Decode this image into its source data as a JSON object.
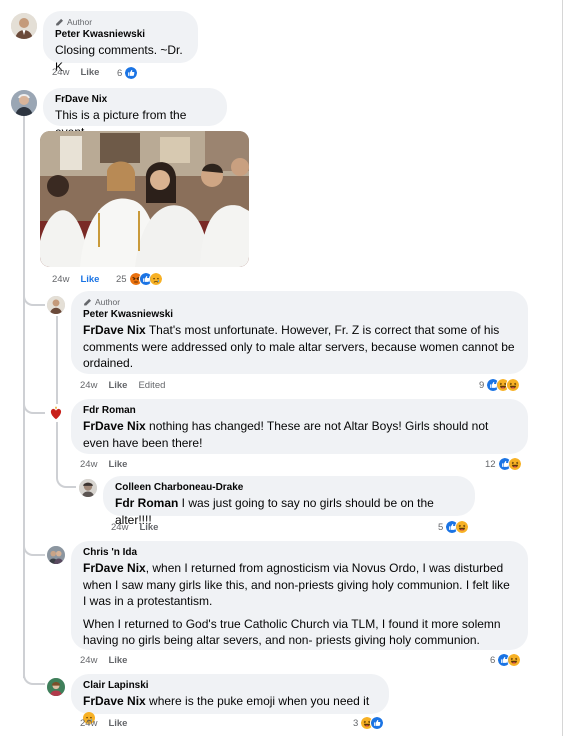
{
  "comments": {
    "c1": {
      "author_tag": "Author",
      "name": "Peter Kwasniewski",
      "text": "Closing comments. ~Dr. K",
      "time": "24w",
      "like": "Like",
      "reaction_count": "6"
    },
    "c2": {
      "name": "FrDave Nix",
      "text": "This is a picture from the event.",
      "time": "24w",
      "like": "Like",
      "reaction_count": "25"
    },
    "r1": {
      "author_tag": "Author",
      "name": "Peter Kwasniewski",
      "mention": "FrDave Nix",
      "text": " That's most unfortunate. However, Fr. Z is correct that some of his comments were addressed only to male altar servers, because women cannot be ordained.",
      "time": "24w",
      "like": "Like",
      "edited": "Edited",
      "reaction_count": "9"
    },
    "r2": {
      "name": "Fdr Roman",
      "mention": "FrDave Nix",
      "text": " nothing has changed! These are not Altar Boys! Girls should not even have been there!",
      "time": "24w",
      "like": "Like",
      "reaction_count": "12"
    },
    "r2a": {
      "name": "Colleen Charboneau-Drake",
      "mention": "Fdr Roman",
      "text": " I was just going to say no girls should be on the alter!!!!",
      "time": "24w",
      "like": "Like",
      "reaction_count": "5"
    },
    "r3": {
      "name": "Chris 'n Ida",
      "mention": "FrDave Nix",
      "text1": ", when I returned from agnosticism via Novus Ordo, I was disturbed when I saw many girls like this, and non-priests giving holy communion. I felt like I was in a protestantism.",
      "text2": "When I returned to God's true Catholic Church via TLM, I found it more solemn having no girls being altar severs, and non- priests giving holy communion.",
      "time": "24w",
      "like": "Like",
      "reaction_count": "6"
    },
    "r4": {
      "name": "Clair Lapinski",
      "mention": "FrDave Nix",
      "text": " where is the puke emoji when you need it ",
      "time": "24w",
      "like": "Like",
      "reaction_count": "3"
    }
  },
  "icons": {
    "like": "like-reaction-icon",
    "haha": "haha-reaction-icon",
    "angry": "angry-reaction-icon",
    "sad": "sad-reaction-icon",
    "wow": "wow-reaction-icon",
    "author_badge": "pencil-icon"
  },
  "colors": {
    "like_blue": "#1b74e4",
    "bubble_bg": "#f0f2f5",
    "meta_gray": "#65676b",
    "reaction_yellow": "#f7b125",
    "angry_orange": "#e9710f"
  }
}
